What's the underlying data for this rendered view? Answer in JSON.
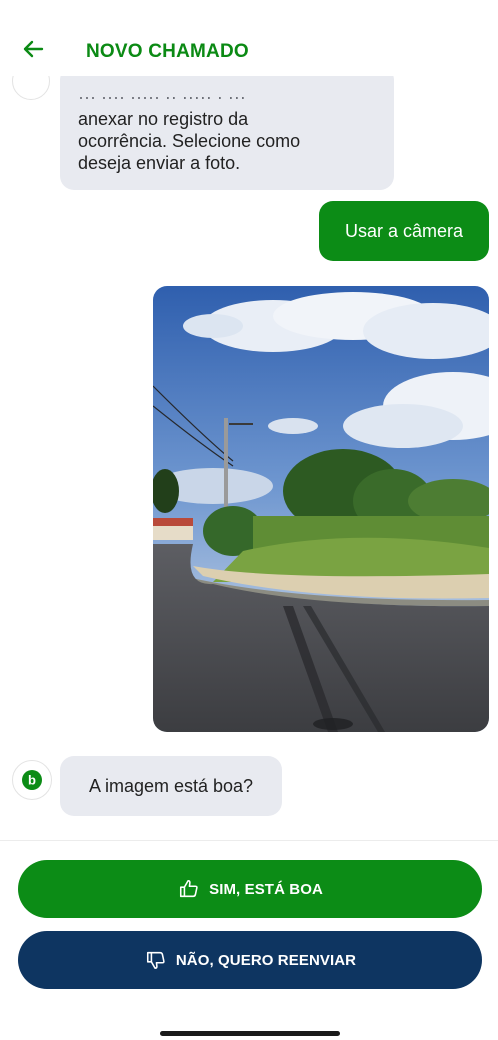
{
  "header": {
    "title": "NOVO CHAMADO",
    "back_icon": "arrow-left-icon"
  },
  "chat": {
    "bot_message_1": {
      "cut_line": "··· ···· ····· ·· ····· · ···",
      "lines": [
        "anexar no registro da",
        "ocorrência. Selecione como",
        "deseja enviar a foto."
      ]
    },
    "user_reply": "Usar a câmera",
    "photo_icon": "street-photo",
    "bot_message_2": "A imagem está boa?",
    "bot_avatar_letter": "b"
  },
  "actions": {
    "yes_label": "SIM, ESTÁ BOA",
    "no_label": "NÃO, QUERO REENVIAR"
  },
  "colors": {
    "primary_green": "#0c8c16",
    "navy": "#0e3561",
    "bubble_gray": "#e8eaf0"
  }
}
